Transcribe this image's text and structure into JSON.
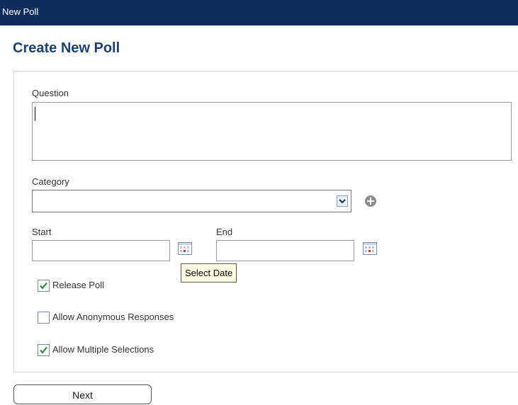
{
  "window": {
    "title": "New Poll"
  },
  "page": {
    "heading": "Create New Poll"
  },
  "form": {
    "question": {
      "label": "Question",
      "value": ""
    },
    "category": {
      "label": "Category",
      "selected": ""
    },
    "start": {
      "label": "Start",
      "value": ""
    },
    "end": {
      "label": "End",
      "value": ""
    },
    "tooltip": "Select Date",
    "options": [
      {
        "label": "Release Poll",
        "checked": true
      },
      {
        "label": "Allow Anonymous Responses",
        "checked": false
      },
      {
        "label": "Allow Multiple Selections",
        "checked": true
      }
    ]
  },
  "actions": {
    "next_label": "Next"
  },
  "colors": {
    "titlebar": "#0d2c5e",
    "heading": "#20406e",
    "check": "#2f8a3a"
  },
  "icons": [
    "dropdown-arrow-icon",
    "add-category-icon",
    "calendar-icon",
    "checkmark-icon"
  ]
}
